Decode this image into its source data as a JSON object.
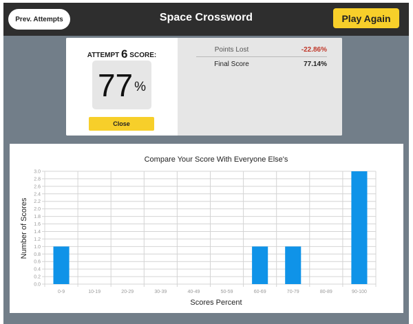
{
  "header": {
    "title": "Space Crossword",
    "prev_attempts_label": "Prev. Attempts",
    "play_again_label": "Play Again"
  },
  "score_card": {
    "attempt_prefix": "ATTEMPT",
    "attempt_number": "6",
    "attempt_suffix": "SCORE:",
    "score_value": "77",
    "score_unit": "%",
    "close_label": "Close",
    "stats": [
      {
        "label": "Points Lost",
        "value": "-22.86%"
      },
      {
        "label": "Final Score",
        "value": "77.14%"
      }
    ]
  },
  "colors": {
    "accent_yellow": "#f7cf2a",
    "bar_blue": "#0f93e8",
    "negative_red": "#c0392b"
  },
  "chart_data": {
    "type": "bar",
    "title": "Compare Your Score With Everyone Else's",
    "xlabel": "Scores Percent",
    "ylabel": "Number of Scores",
    "categories": [
      "0-9",
      "10-19",
      "20-29",
      "30-39",
      "40-49",
      "50-59",
      "60-69",
      "70-79",
      "80-89",
      "90-100"
    ],
    "values": [
      1,
      0,
      0,
      0,
      0,
      0,
      1,
      1,
      0,
      3
    ],
    "ylim": [
      0,
      3
    ],
    "ytick_step": 0.2,
    "grid": true,
    "legend": false
  }
}
